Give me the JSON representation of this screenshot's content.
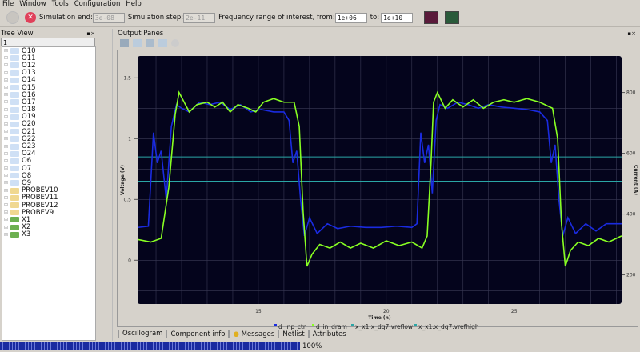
{
  "menu": [
    "File",
    "Window",
    "Tools",
    "Configuration",
    "Help"
  ],
  "toolbar": {
    "sim_end_label": "Simulation end:",
    "sim_end": "3e-08",
    "sim_step_label": "Simulation step:",
    "sim_step": "2e-11",
    "freq_label": "Frequency range of interest, from:",
    "freq_from": "1e+06",
    "to_label": "to:",
    "freq_to": "1e+10"
  },
  "tree": {
    "title": "Tree View",
    "filter": "1",
    "items": [
      {
        "label": "O10",
        "type": "net"
      },
      {
        "label": "O11",
        "type": "net"
      },
      {
        "label": "O12",
        "type": "net"
      },
      {
        "label": "O13",
        "type": "net"
      },
      {
        "label": "O14",
        "type": "net"
      },
      {
        "label": "O15",
        "type": "net"
      },
      {
        "label": "O16",
        "type": "net"
      },
      {
        "label": "O17",
        "type": "net"
      },
      {
        "label": "O18",
        "type": "net"
      },
      {
        "label": "O19",
        "type": "net"
      },
      {
        "label": "O20",
        "type": "net"
      },
      {
        "label": "O21",
        "type": "net"
      },
      {
        "label": "O22",
        "type": "net"
      },
      {
        "label": "O23",
        "type": "net"
      },
      {
        "label": "O24",
        "type": "net"
      },
      {
        "label": "O6",
        "type": "net"
      },
      {
        "label": "O7",
        "type": "net"
      },
      {
        "label": "O8",
        "type": "net"
      },
      {
        "label": "O9",
        "type": "net"
      },
      {
        "label": "PROBEV10",
        "type": "probe"
      },
      {
        "label": "PROBEV11",
        "type": "probe"
      },
      {
        "label": "PROBEV12",
        "type": "probe"
      },
      {
        "label": "PROBEV9",
        "type": "probe"
      },
      {
        "label": "X1",
        "type": "component"
      },
      {
        "label": "X2",
        "type": "component"
      },
      {
        "label": "X3",
        "type": "component"
      }
    ]
  },
  "output": {
    "title": "Output Panes"
  },
  "tabs": [
    "Oscillogram",
    "Component info",
    "Messages",
    "Netlist",
    "Attributes"
  ],
  "progress": {
    "value": 100,
    "label": "100%"
  },
  "colors": {
    "green": "#88ff22",
    "blue": "#1a2be0",
    "cyan": "#2aa6a6",
    "plot_bg": "#04041c"
  },
  "chart_data": {
    "type": "line",
    "xlabel": "Time (n)",
    "ylabel": "Voltage (V)",
    "y2label": "Current (A)",
    "xlim": [
      10.28,
      29.2
    ],
    "ylim": [
      -0.36,
      1.68
    ],
    "y2lim": [
      104,
      920
    ],
    "xticks": [
      15,
      20,
      25
    ],
    "yticks": [
      0,
      0.5,
      1,
      1.5
    ],
    "y2ticks": [
      200,
      400,
      600,
      800
    ],
    "xticklabels": [
      "15",
      "20",
      "25"
    ],
    "yticklabels": [
      "0",
      "0.5",
      "1",
      "1.5"
    ],
    "y2ticklabels": [
      "200",
      "400",
      "600",
      "800"
    ],
    "legend_position": "bottom",
    "series": [
      {
        "name": "d_inp_ctr",
        "color": "#1a2be0",
        "points": [
          [
            10.3,
            0.27
          ],
          [
            10.7,
            0.28
          ],
          [
            10.9,
            1.05
          ],
          [
            11.05,
            0.8
          ],
          [
            11.2,
            0.9
          ],
          [
            11.4,
            0.5
          ],
          [
            11.6,
            1.1
          ],
          [
            11.8,
            1.28
          ],
          [
            12.0,
            1.25
          ],
          [
            12.3,
            1.22
          ],
          [
            12.7,
            1.3
          ],
          [
            13.1,
            1.28
          ],
          [
            13.5,
            1.3
          ],
          [
            13.9,
            1.24
          ],
          [
            14.3,
            1.28
          ],
          [
            14.7,
            1.22
          ],
          [
            15.1,
            1.24
          ],
          [
            15.6,
            1.22
          ],
          [
            16.0,
            1.22
          ],
          [
            16.2,
            1.15
          ],
          [
            16.35,
            0.8
          ],
          [
            16.5,
            0.9
          ],
          [
            16.65,
            0.5
          ],
          [
            16.8,
            0.2
          ],
          [
            17.0,
            0.35
          ],
          [
            17.3,
            0.22
          ],
          [
            17.7,
            0.3
          ],
          [
            18.1,
            0.26
          ],
          [
            18.6,
            0.28
          ],
          [
            19.2,
            0.27
          ],
          [
            19.8,
            0.27
          ],
          [
            20.4,
            0.28
          ],
          [
            21.0,
            0.27
          ],
          [
            21.2,
            0.3
          ],
          [
            21.35,
            1.05
          ],
          [
            21.5,
            0.8
          ],
          [
            21.65,
            0.95
          ],
          [
            21.8,
            0.55
          ],
          [
            21.95,
            1.15
          ],
          [
            22.1,
            1.28
          ],
          [
            22.4,
            1.25
          ],
          [
            22.8,
            1.3
          ],
          [
            23.2,
            1.28
          ],
          [
            23.6,
            1.25
          ],
          [
            24.0,
            1.28
          ],
          [
            24.5,
            1.26
          ],
          [
            25.0,
            1.25
          ],
          [
            25.5,
            1.24
          ],
          [
            26.0,
            1.22
          ],
          [
            26.3,
            1.15
          ],
          [
            26.45,
            0.8
          ],
          [
            26.6,
            0.95
          ],
          [
            26.75,
            0.5
          ],
          [
            26.9,
            0.2
          ],
          [
            27.1,
            0.35
          ],
          [
            27.4,
            0.22
          ],
          [
            27.8,
            0.3
          ],
          [
            28.2,
            0.24
          ],
          [
            28.6,
            0.3
          ],
          [
            29.2,
            0.3
          ]
        ]
      },
      {
        "name": "d_in_dram",
        "color": "#88ff22",
        "points": [
          [
            10.3,
            0.17
          ],
          [
            10.8,
            0.15
          ],
          [
            11.2,
            0.18
          ],
          [
            11.5,
            0.6
          ],
          [
            11.75,
            1.2
          ],
          [
            11.9,
            1.38
          ],
          [
            12.1,
            1.3
          ],
          [
            12.3,
            1.22
          ],
          [
            12.6,
            1.28
          ],
          [
            13.0,
            1.3
          ],
          [
            13.3,
            1.26
          ],
          [
            13.6,
            1.3
          ],
          [
            13.9,
            1.22
          ],
          [
            14.2,
            1.28
          ],
          [
            14.6,
            1.25
          ],
          [
            14.9,
            1.22
          ],
          [
            15.2,
            1.3
          ],
          [
            15.6,
            1.33
          ],
          [
            16.0,
            1.3
          ],
          [
            16.4,
            1.3
          ],
          [
            16.6,
            1.1
          ],
          [
            16.75,
            0.4
          ],
          [
            16.9,
            -0.05
          ],
          [
            17.1,
            0.05
          ],
          [
            17.4,
            0.13
          ],
          [
            17.8,
            0.1
          ],
          [
            18.2,
            0.15
          ],
          [
            18.6,
            0.1
          ],
          [
            19.0,
            0.14
          ],
          [
            19.5,
            0.1
          ],
          [
            20.0,
            0.16
          ],
          [
            20.5,
            0.12
          ],
          [
            21.0,
            0.15
          ],
          [
            21.4,
            0.1
          ],
          [
            21.6,
            0.2
          ],
          [
            21.75,
            0.8
          ],
          [
            21.85,
            1.3
          ],
          [
            22.0,
            1.38
          ],
          [
            22.3,
            1.25
          ],
          [
            22.6,
            1.32
          ],
          [
            23.0,
            1.26
          ],
          [
            23.4,
            1.32
          ],
          [
            23.8,
            1.25
          ],
          [
            24.2,
            1.3
          ],
          [
            24.6,
            1.32
          ],
          [
            25.0,
            1.3
          ],
          [
            25.5,
            1.33
          ],
          [
            26.0,
            1.3
          ],
          [
            26.5,
            1.25
          ],
          [
            26.7,
            1.0
          ],
          [
            26.85,
            0.3
          ],
          [
            27.0,
            -0.05
          ],
          [
            27.2,
            0.08
          ],
          [
            27.5,
            0.15
          ],
          [
            27.9,
            0.12
          ],
          [
            28.3,
            0.18
          ],
          [
            28.7,
            0.15
          ],
          [
            29.2,
            0.2
          ]
        ]
      },
      {
        "name": "x_x1.x_dq7.vreflow",
        "color": "#2aa6a6",
        "points": [
          [
            10.28,
            0.65
          ],
          [
            29.2,
            0.65
          ]
        ]
      },
      {
        "name": "x_x1.x_dq7.vrefhigh",
        "color": "#2aa6a6",
        "points": [
          [
            10.28,
            0.85
          ],
          [
            29.2,
            0.85
          ]
        ]
      }
    ]
  }
}
